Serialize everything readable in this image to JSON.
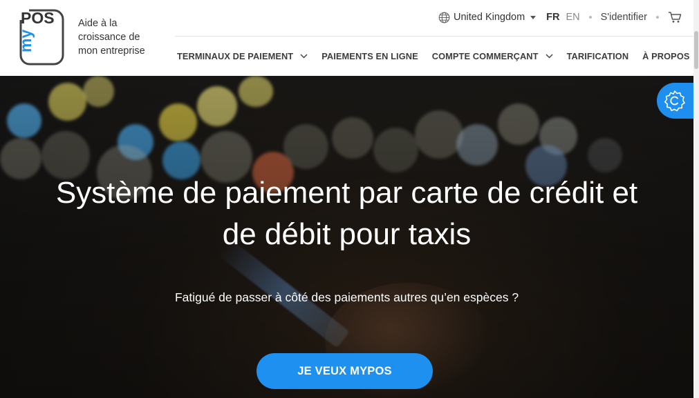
{
  "brand": {
    "logo_text_pos": "POS",
    "logo_text_my": "my",
    "tagline": "Aide à la croissance de mon entreprise"
  },
  "top_bar": {
    "country": "United Kingdom",
    "lang_active": "FR",
    "lang_other": "EN",
    "login": "S'identifier"
  },
  "nav": {
    "items": [
      {
        "label": "TERMINAUX DE PAIEMENT",
        "has_dropdown": true
      },
      {
        "label": "PAIEMENTS EN LIGNE",
        "has_dropdown": false
      },
      {
        "label": "COMPTE COMMERÇANT",
        "has_dropdown": true
      },
      {
        "label": "TARIFICATION",
        "has_dropdown": false
      },
      {
        "label": "À PROPOS",
        "has_dropdown": true
      }
    ]
  },
  "hero": {
    "title_line1": "Système de paiement par carte de crédit et",
    "title_line2": "de débit pour taxis",
    "subtitle": "Fatigué de passer à côté des paiements autres qu’en espèces ?",
    "cta": "JE VEUX MYPOS"
  },
  "icons": {
    "globe": "globe-icon",
    "cart": "cart-icon",
    "chevron": "chevron-down-icon",
    "settings": "cookie-settings-icon"
  },
  "colors": {
    "accent": "#1e90f0",
    "nav_text": "#3c3c3c",
    "hero_text": "#ffffff"
  }
}
